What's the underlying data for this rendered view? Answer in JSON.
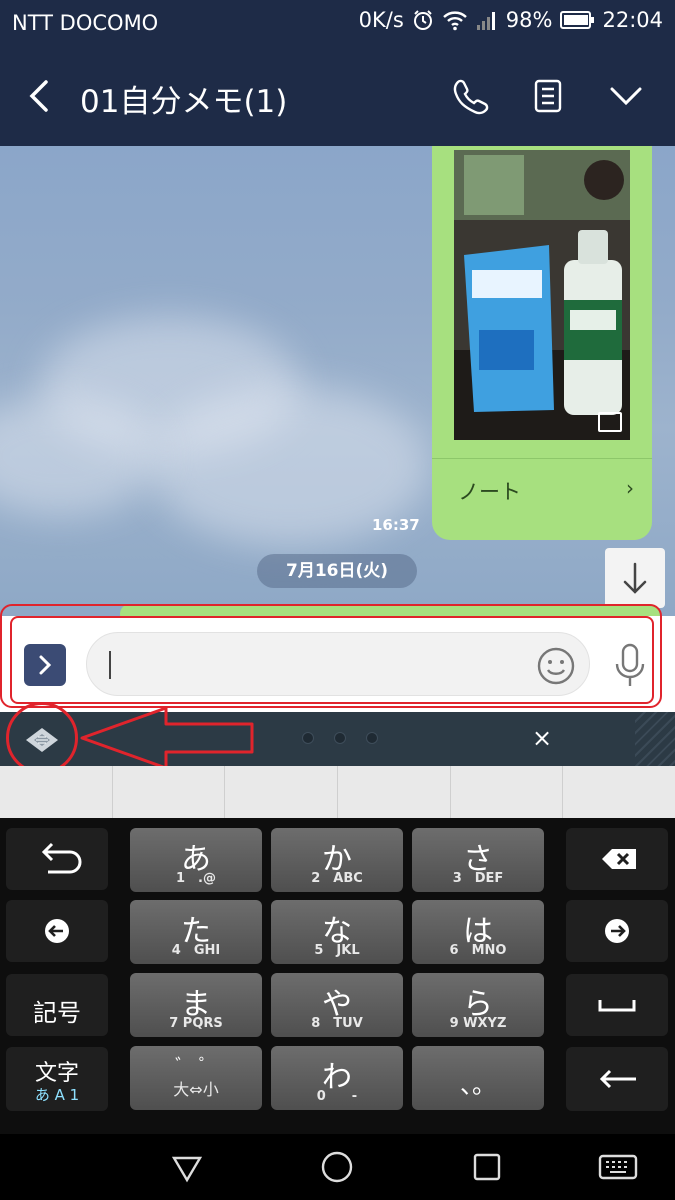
{
  "status_bar": {
    "carrier": "NTT DOCOMO",
    "speed": "0K/s",
    "battery": "98%",
    "time": "22:04"
  },
  "header": {
    "title": "01自分メモ(1)"
  },
  "chat": {
    "note_label": "ノート",
    "note_arrow": "›",
    "time": "16:37",
    "date": "7月16日(火)"
  },
  "keyboard": {
    "close": "×",
    "keys": {
      "a_kana": "あ",
      "a_sub": "1　.@",
      "ka_kana": "か",
      "ka_sub": "2　ABC",
      "sa_kana": "さ",
      "sa_sub": "3　DEF",
      "ta_kana": "た",
      "ta_sub": "4　GHI",
      "na_kana": "な",
      "na_sub": "5　JKL",
      "ha_kana": "は",
      "ha_sub": "6　MNO",
      "ma_kana": "ま",
      "ma_sub": "7 PQRS",
      "ya_kana": "や",
      "ya_sub": "8　TUV",
      "ra_kana": "ら",
      "ra_sub": "9 WXYZ",
      "wa_kana": "わ",
      "wa_sub": "0　　-",
      "dakuten_top": "゛ ゜",
      "dakuten_bottom": "大⇔小",
      "punct": "、。",
      "kigou": "記号",
      "moji": "文字",
      "moji_sub": "あ A 1"
    }
  },
  "colors": {
    "header_bg": "#1e2b47",
    "bubble_green": "#a7e07f",
    "annotation_red": "#e0242c"
  }
}
